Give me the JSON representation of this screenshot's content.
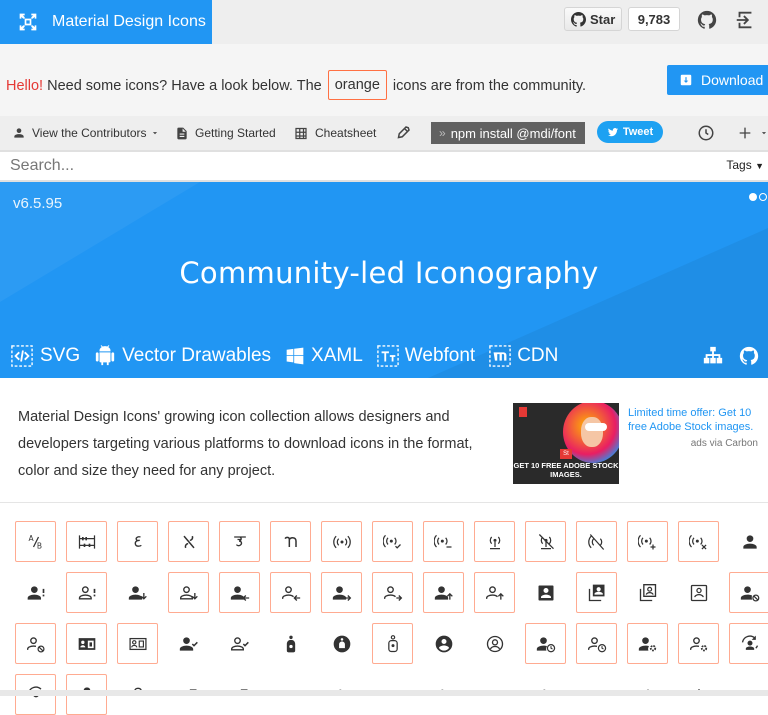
{
  "header": {
    "brand_title": "Material Design Icons",
    "star_label": "Star",
    "star_count": "9,783",
    "github_icon": "github-icon",
    "logout_icon": "exit-icon"
  },
  "hello": {
    "greeting": "Hello!",
    "text_before": " Need some icons? Have a look below. The ",
    "orange_label": "orange",
    "text_after": " icons are from the community.",
    "download_label": "Download"
  },
  "toolbar": {
    "contributors_label": "View the Contributors",
    "getting_started_label": "Getting Started",
    "cheatsheet_label": "Cheatsheet",
    "npm_arrow": "»",
    "npm_label": "npm install @mdi/font",
    "tweet_label": "Tweet"
  },
  "search": {
    "placeholder": "Search...",
    "tags_label": "Tags"
  },
  "hero": {
    "version": "v6.5.95",
    "title": "Community-led Iconography",
    "platforms": [
      "SVG",
      "Vector Drawables",
      "XAML",
      "Webfont",
      "CDN"
    ]
  },
  "intro": {
    "text": "Material Design Icons' growing icon collection allows designers and developers targeting various platforms to download icons in the format, color and size they need for any project."
  },
  "ad": {
    "offer_text": "Limited time offer: Get 10 free Adobe Stock images.",
    "via_text": "ads via Carbon",
    "image_caption": "GET 10 FREE ADOBE STOCK IMAGES.",
    "st_badge": "St"
  },
  "colors": {
    "primary": "#2196f3",
    "community_border": "#ffab91",
    "hello_red": "#e53935"
  }
}
